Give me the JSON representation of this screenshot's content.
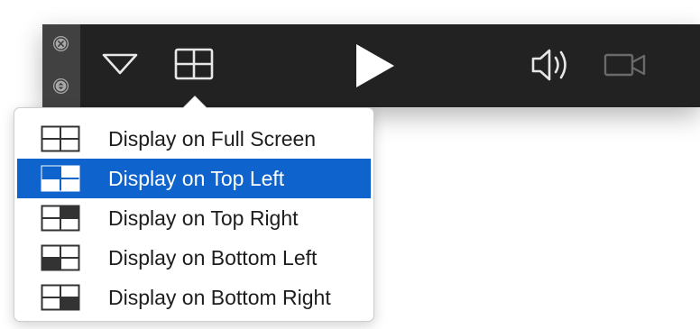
{
  "hud": {
    "window_buttons": [
      "close",
      "minimize"
    ],
    "controls": [
      "chevron-down-icon",
      "grid-layout-icon",
      "play-icon",
      "speaker-icon",
      "video-camera-icon"
    ]
  },
  "display_menu": {
    "items": [
      {
        "label": "Display on Full Screen",
        "icon": "full-screen-grid-icon",
        "selected": false
      },
      {
        "label": "Display on Top Left",
        "icon": "top-left-grid-icon",
        "selected": true
      },
      {
        "label": "Display on Top Right",
        "icon": "top-right-grid-icon",
        "selected": false
      },
      {
        "label": "Display on Bottom Left",
        "icon": "bottom-left-grid-icon",
        "selected": false
      },
      {
        "label": "Display on Bottom Right",
        "icon": "bottom-right-grid-icon",
        "selected": false
      }
    ]
  },
  "colors": {
    "hud_background": "#222222",
    "hud_sidebar": "#414141",
    "selection": "#0e63cc",
    "menu_text": "#1d1d1d"
  }
}
